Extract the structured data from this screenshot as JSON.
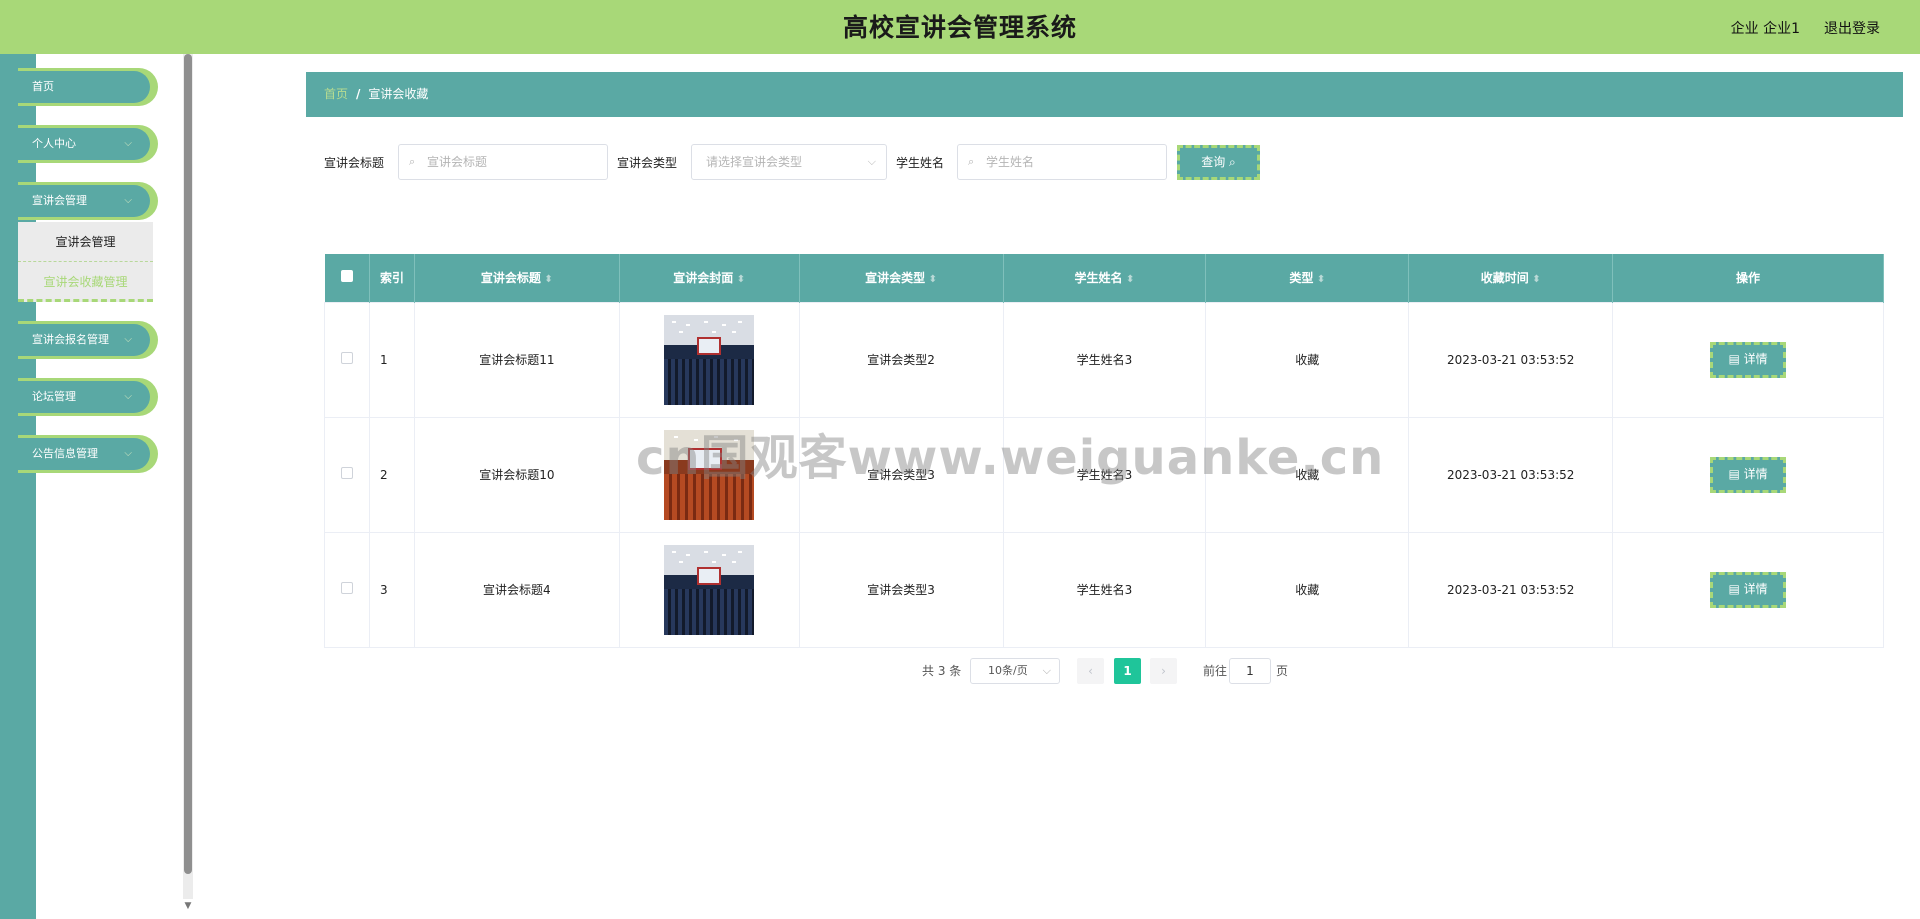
{
  "header": {
    "title": "高校宣讲会管理系统",
    "user": "企业 企业1",
    "logout": "退出登录"
  },
  "sidebar": {
    "items": [
      {
        "label": "首页"
      },
      {
        "label": "个人中心"
      },
      {
        "label": "宣讲会管理"
      },
      {
        "label": "宣讲会报名管理"
      },
      {
        "label": "论坛管理"
      },
      {
        "label": "公告信息管理"
      }
    ],
    "submenu": [
      {
        "label": "宣讲会管理"
      },
      {
        "label": "宣讲会收藏管理"
      }
    ]
  },
  "breadcrumb": {
    "home": "首页",
    "separator": "/",
    "current": "宣讲会收藏"
  },
  "search": {
    "title_label": "宣讲会标题",
    "title_placeholder": "宣讲会标题",
    "type_label": "宣讲会类型",
    "type_placeholder": "请选择宣讲会类型",
    "student_label": "学生姓名",
    "student_placeholder": "学生姓名",
    "button": "查询"
  },
  "table": {
    "headers": [
      "索引",
      "宣讲会标题",
      "宣讲会封面",
      "宣讲会类型",
      "学生姓名",
      "类型",
      "收藏时间",
      "操作"
    ],
    "rows": [
      {
        "index": "1",
        "title": "宣讲会标题11",
        "type": "宣讲会类型2",
        "student": "学生姓名3",
        "kind": "收藏",
        "time": "2023-03-21 03:53:52",
        "action": "详情"
      },
      {
        "index": "2",
        "title": "宣讲会标题10",
        "type": "宣讲会类型3",
        "student": "学生姓名3",
        "kind": "收藏",
        "time": "2023-03-21 03:53:52",
        "action": "详情"
      },
      {
        "index": "3",
        "title": "宣讲会标题4",
        "type": "宣讲会类型3",
        "student": "学生姓名3",
        "kind": "收藏",
        "time": "2023-03-21 03:53:52",
        "action": "详情"
      }
    ]
  },
  "pagination": {
    "total": "共 3 条",
    "page_size": "10条/页",
    "current_page": "1",
    "goto_label": "前往",
    "goto_value": "1",
    "page_unit": "页"
  },
  "watermark": "cn国观客www.weiguanke.cn",
  "colors": {
    "header": "#a8d878",
    "teal": "#5aa9a4",
    "active_page": "#1fc59a"
  }
}
